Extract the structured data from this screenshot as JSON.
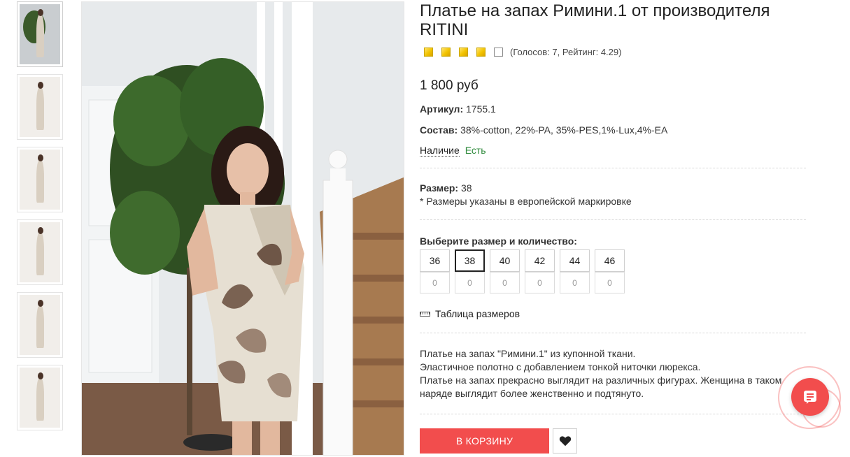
{
  "product": {
    "title": "Платье на запах Римини.1 от производителя RITINI",
    "rating": {
      "stars": [
        1,
        1,
        1,
        1,
        0
      ],
      "votes_text": "(Голосов: 7, Рейтинг: 4.29)"
    },
    "price": "1 800 руб",
    "article_label": "Артикул:",
    "article_value": "1755.1",
    "composition_label": "Состав:",
    "composition_value": "38%-cotton, 22%-PA, 35%-PES,1%-Lux,4%-EA",
    "availability_label": "Наличие",
    "availability_value": "Есть",
    "size_label": "Размер:",
    "size_value": "38",
    "size_note": "* Размеры указаны в европейской маркировке",
    "choose_label": "Выберите размер и количество:",
    "sizes": [
      {
        "label": "36",
        "qty": "0"
      },
      {
        "label": "38",
        "qty": "0"
      },
      {
        "label": "40",
        "qty": "0"
      },
      {
        "label": "42",
        "qty": "0"
      },
      {
        "label": "44",
        "qty": "0"
      },
      {
        "label": "46",
        "qty": "0"
      }
    ],
    "selected_size": "38",
    "size_table_link": "Таблица размеров",
    "description": [
      "Платье на запах \"Римини.1\" из купонной ткани.",
      "Эластичное полотно с добавлением тонкой ниточки люрекса.",
      "Платье на запах прекрасно выглядит на различных фигурах. Женщина в таком",
      "наряде выглядит более женственно и подтянуто."
    ],
    "cart_button": "В КОРЗИНУ"
  },
  "colors": {
    "accent": "#f24d4d",
    "availability": "#2e8a3b",
    "star": "#f2c300"
  },
  "icons": {
    "ruler": "ruler-icon",
    "heart": "heart-icon",
    "chat": "chat-icon"
  }
}
